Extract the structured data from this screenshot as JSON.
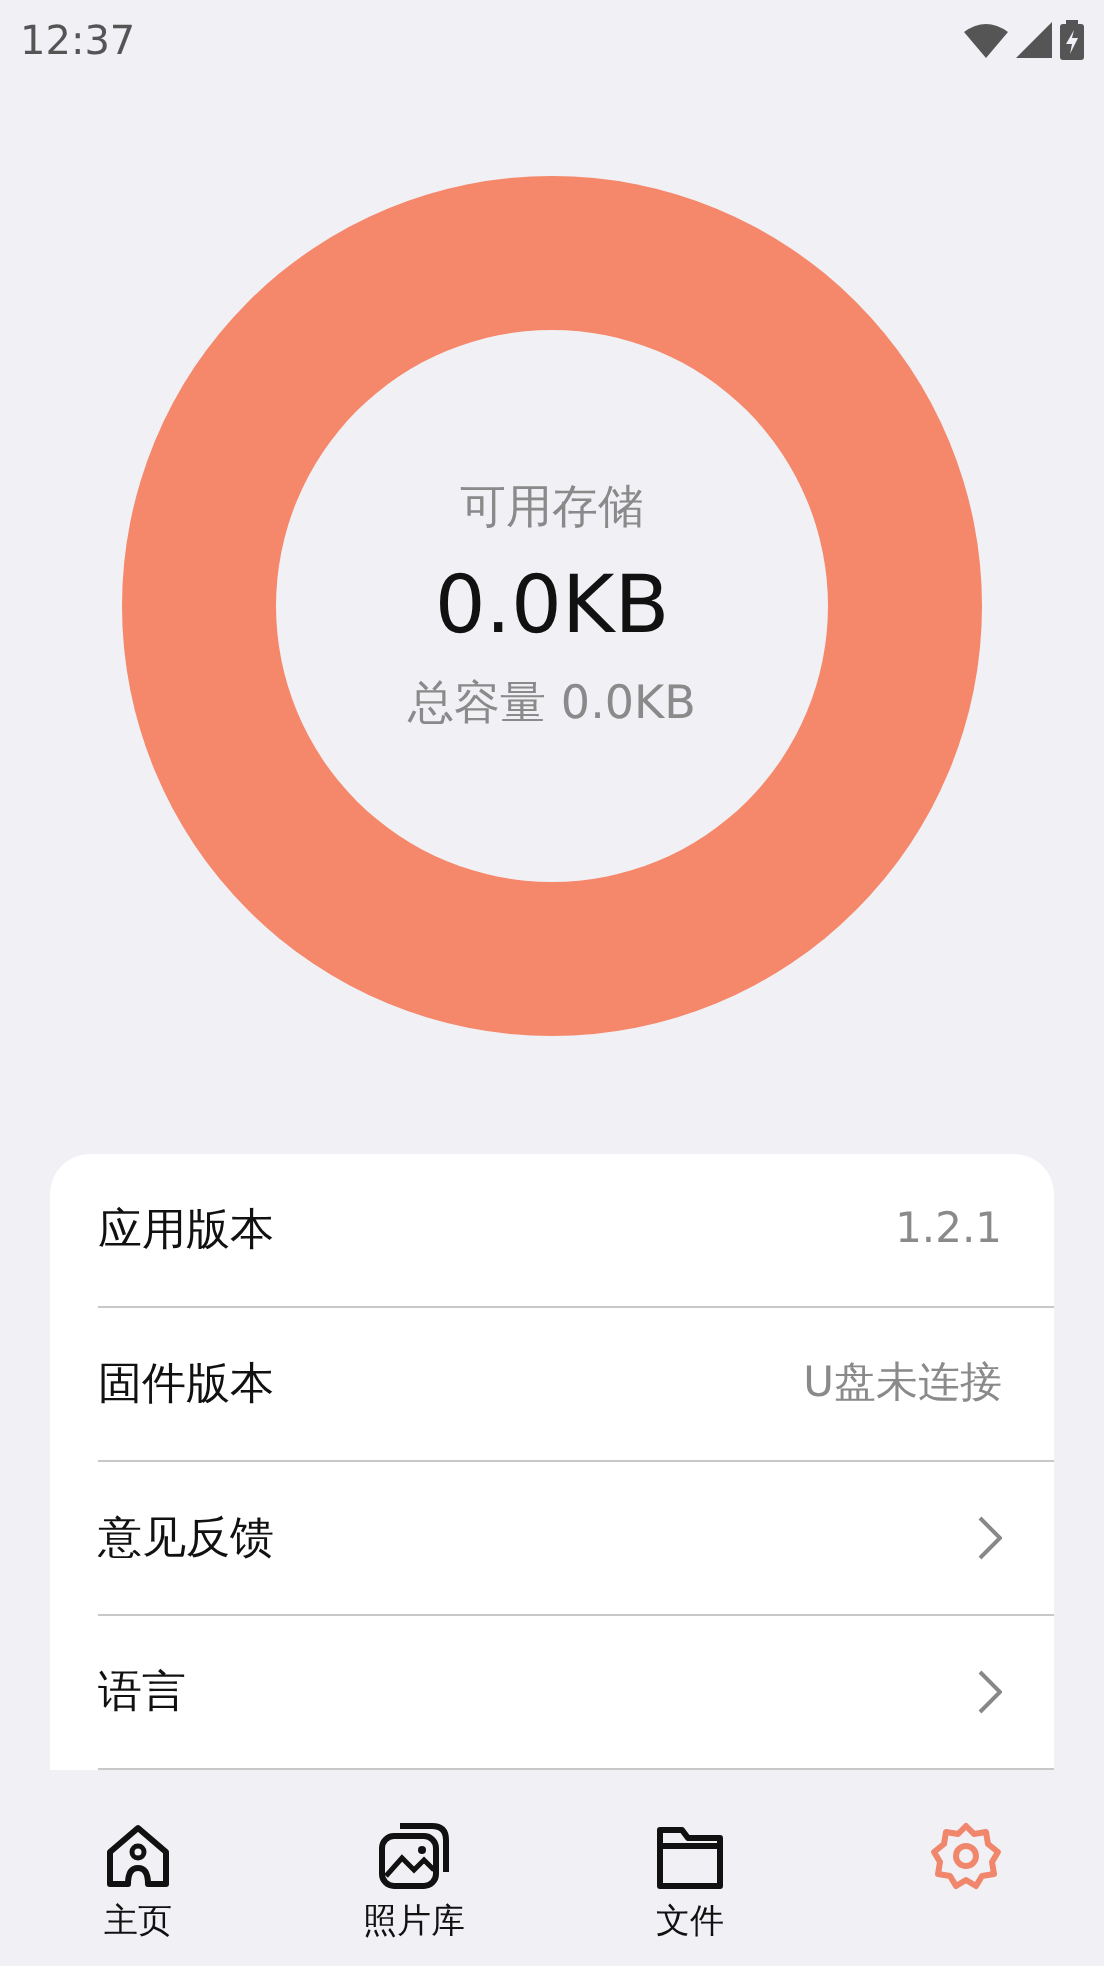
{
  "status_bar": {
    "time": "12:37"
  },
  "storage": {
    "label": "可用存储",
    "available": "0.0KB",
    "total": "总容量 0.0KB"
  },
  "settings": [
    {
      "kind": "value",
      "label": "应用版本",
      "value": "1.2.1"
    },
    {
      "kind": "value",
      "label": "固件版本",
      "value": "U盘未连接"
    },
    {
      "kind": "link",
      "label": "意见反馈"
    },
    {
      "kind": "link",
      "label": "语言"
    }
  ],
  "tabs": [
    {
      "kind": "home",
      "label": "主页",
      "selected": false
    },
    {
      "kind": "gallery",
      "label": "照片库",
      "selected": false
    },
    {
      "kind": "folder",
      "label": "文件",
      "selected": false
    },
    {
      "kind": "gear",
      "selected": true
    }
  ]
}
